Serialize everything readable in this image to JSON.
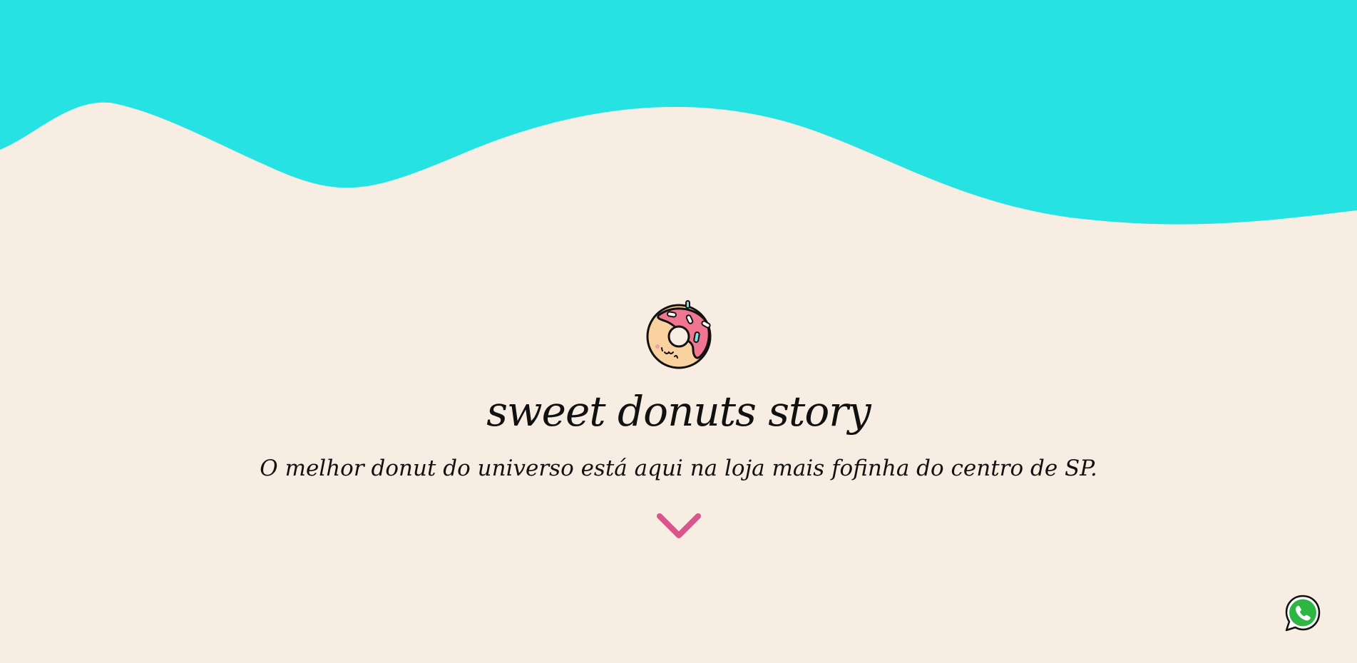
{
  "hero": {
    "title": "sweet donuts story",
    "subtitle": "O melhor donut do universo está aqui na loja mais fofinha do centro de SP."
  },
  "icons": {
    "logo": "donut-icon",
    "scroll": "chevron-down-icon",
    "chat": "whatsapp-icon"
  },
  "colors": {
    "wave": "#26e2e3",
    "background": "#f8ede2",
    "chevron": "#d9558b",
    "text": "#111111",
    "donut_icing": "#f07590",
    "donut_dough": "#fad2a0",
    "whatsapp": "#2db742"
  }
}
